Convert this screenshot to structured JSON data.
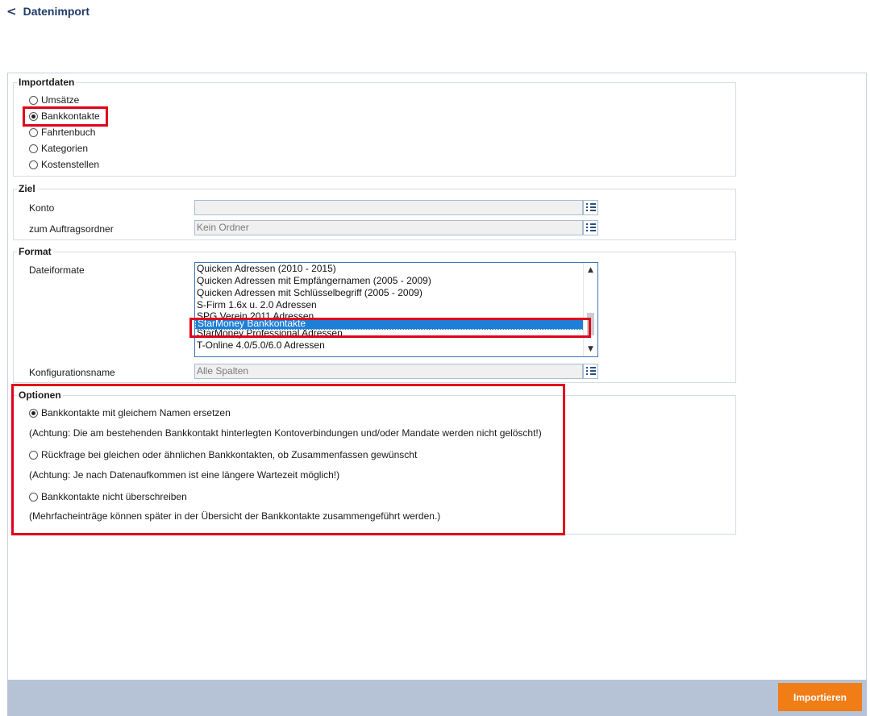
{
  "header": {
    "back_title": "Datenimport"
  },
  "importdaten": {
    "legend": "Importdaten",
    "options": [
      {
        "label": "Umsätze",
        "checked": false
      },
      {
        "label": "Bankkontakte",
        "checked": true
      },
      {
        "label": "Fahrtenbuch",
        "checked": false
      },
      {
        "label": "Kategorien",
        "checked": false
      },
      {
        "label": "Kostenstellen",
        "checked": false
      }
    ]
  },
  "ziel": {
    "legend": "Ziel",
    "konto_label": "Konto",
    "konto_value": "",
    "ordner_label": "zum Auftragsordner",
    "ordner_value": "Kein Ordner"
  },
  "format": {
    "legend": "Format",
    "dateiformate_label": "Dateiformate",
    "items": [
      "Quicken Adressen (2010 - 2015)",
      "Quicken Adressen mit Empfängernamen (2005 - 2009)",
      "Quicken Adressen mit Schlüsselbegriff (2005 - 2009)",
      "S-Firm 1.6x u. 2.0 Adressen",
      "SPG Verein 2011 Adressen",
      "StarMoney Bankkontakte",
      "StarMoney Professional Adressen",
      "T-Online 4.0/5.0/6.0 Adressen"
    ],
    "selected": "StarMoney Bankkontakte",
    "konfig_label": "Konfigurationsname",
    "konfig_value": "Alle Spalten"
  },
  "optionen": {
    "legend": "Optionen",
    "choices": [
      {
        "label": "Bankkontakte mit gleichem Namen ersetzen",
        "checked": true,
        "note": "(Achtung: Die am bestehenden Bankkontakt hinterlegten Kontoverbindungen und/oder Mandate werden nicht gelöscht!)"
      },
      {
        "label": "Rückfrage bei gleichen oder ähnlichen Bankkontakten, ob Zusammenfassen gewünscht",
        "checked": false,
        "note": "(Achtung: Je nach Datenaufkommen ist eine längere Wartezeit möglich!)"
      },
      {
        "label": "Bankkontakte nicht überschreiben",
        "checked": false,
        "note": "(Mehrfacheinträge können später in der Übersicht der Bankkontakte zusammengeführt werden.)"
      }
    ]
  },
  "footer": {
    "import_label": "Importieren"
  },
  "colors": {
    "accent": "#f07d16",
    "highlight": "#e0001b",
    "selection": "#1f7fd6"
  }
}
